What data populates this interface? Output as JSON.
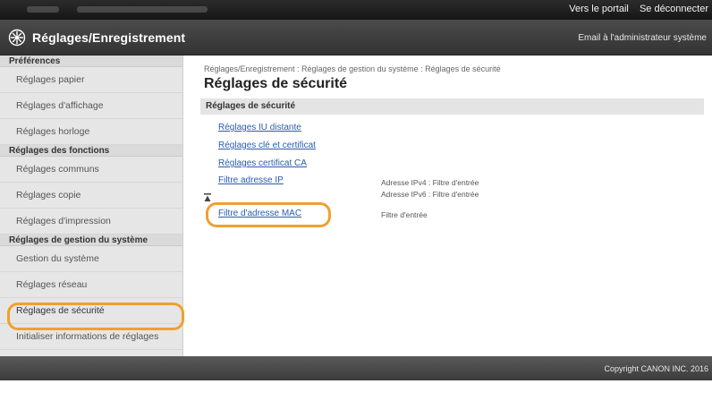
{
  "topbar": {
    "portal_link": "Vers le portail",
    "logout_link": "Se déconnecter"
  },
  "header": {
    "title": "Réglages/Enregistrement",
    "admin_email": "Email à l'administrateur système"
  },
  "sidebar": {
    "groups": [
      {
        "label": "Préférences",
        "items": [
          "Réglages papier",
          "Réglages d'affichage",
          "Réglages horloge"
        ]
      },
      {
        "label": "Réglages des fonctions",
        "items": [
          "Réglages communs",
          "Réglages copie",
          "Réglages d'impression"
        ]
      },
      {
        "label": "Réglages de gestion du système",
        "items": [
          "Gestion du système",
          "Réglages réseau",
          "Réglages de sécurité",
          "Initialiser informations de réglages"
        ]
      }
    ],
    "active_item": "Réglages de sécurité"
  },
  "main": {
    "breadcrumb": "Réglages/Enregistrement : Réglages de gestion du système : Réglages de sécurité",
    "title": "Réglages de sécurité",
    "section_header": "Réglages de sécurité",
    "links": {
      "remote_ui": "Réglages IU distante",
      "key_cert": "Réglages clé et certificat",
      "ca_cert": "Réglages certificat CA",
      "ip_filter": "Filtre adresse IP",
      "mac_filter": "Filtre d'adresse MAC"
    },
    "values": {
      "ipv4": "Adresse IPv4 : Filtre d'entrée",
      "ipv6": "Adresse IPv6 : Filtre d'entrée",
      "mac": "Filtre d'entrée"
    }
  },
  "footer": {
    "copyright": "Copyright CANON INC. 2016"
  },
  "colors": {
    "highlight": "#f0a030",
    "link": "#2b5cab"
  }
}
